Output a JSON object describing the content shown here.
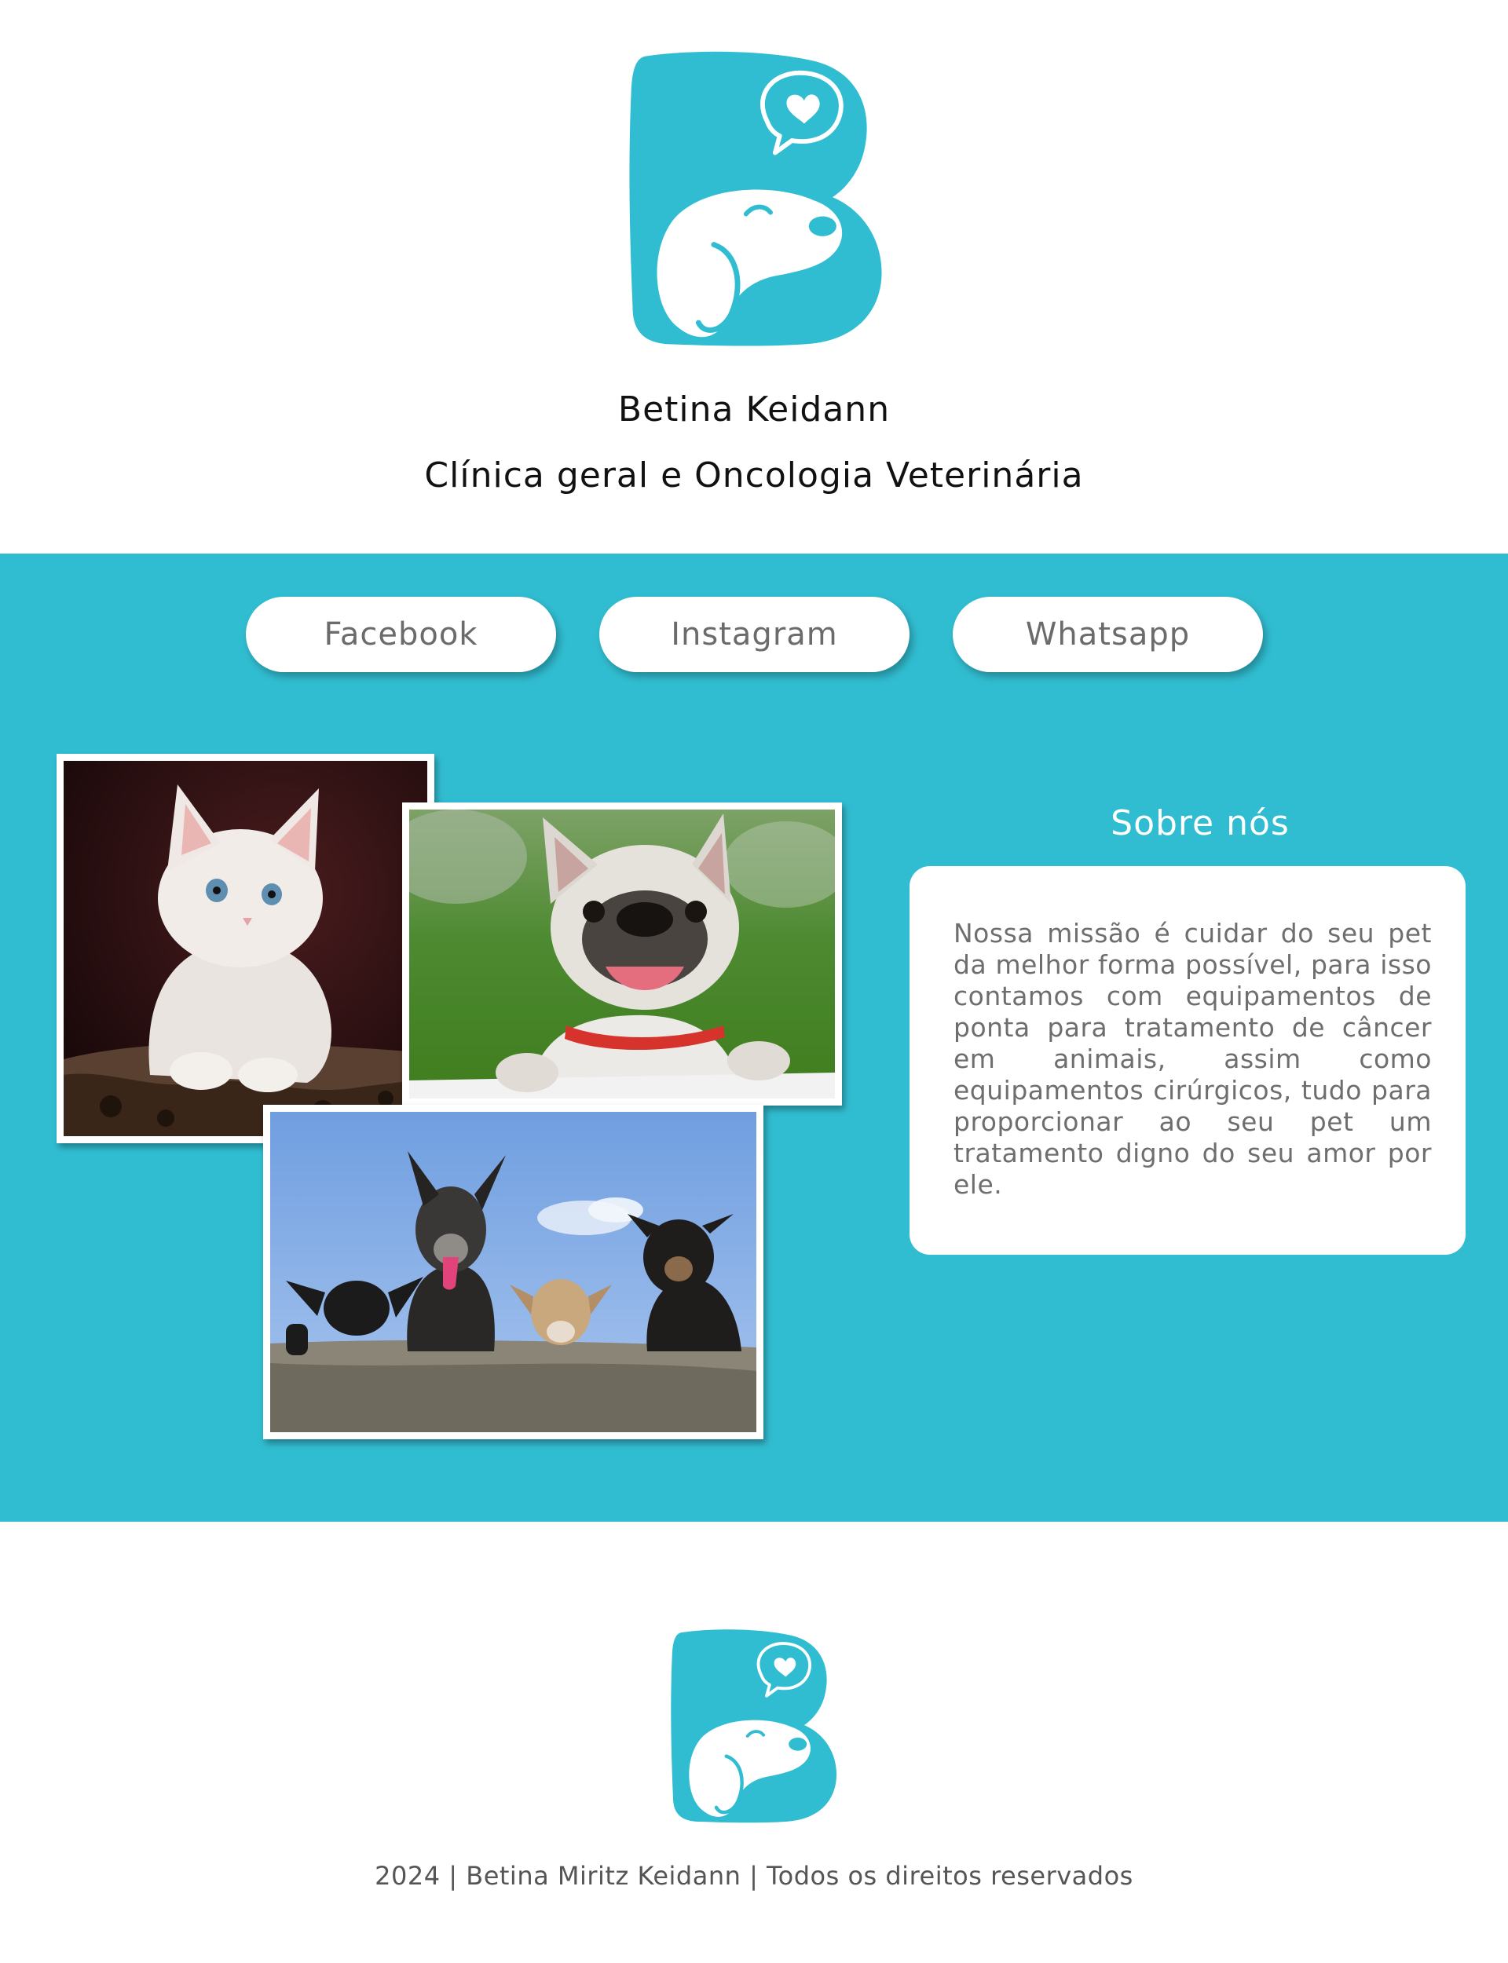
{
  "header": {
    "name": "Betina Keidann",
    "subtitle": "Clínica geral e Oncologia Veterinária"
  },
  "social": {
    "facebook": "Facebook",
    "instagram": "Instagram",
    "whatsapp": "Whatsapp"
  },
  "about": {
    "title": "Sobre nós",
    "text": "Nossa missão é cuidar do seu pet da melhor forma possível, para isso contamos com equipamentos de ponta para tratamento de câncer em animais, assim como equipamentos cirúrgicos, tudo para proporcionar ao seu pet um tratamento digno do seu amor por ele."
  },
  "photos": [
    "kitten-photo",
    "french-bulldog-photo",
    "dogs-on-wall-photo"
  ],
  "footer": {
    "copyright": "2024 | Betina Miritz Keidann | Todos os direitos reservados"
  },
  "colors": {
    "brand_teal": "#31bdd1",
    "white": "#ffffff",
    "button_text": "#6b6b6b",
    "body_text": "#6e6e6e"
  },
  "icons": [
    "logo-b-dog-icon",
    "heart-speech-bubble-icon"
  ]
}
